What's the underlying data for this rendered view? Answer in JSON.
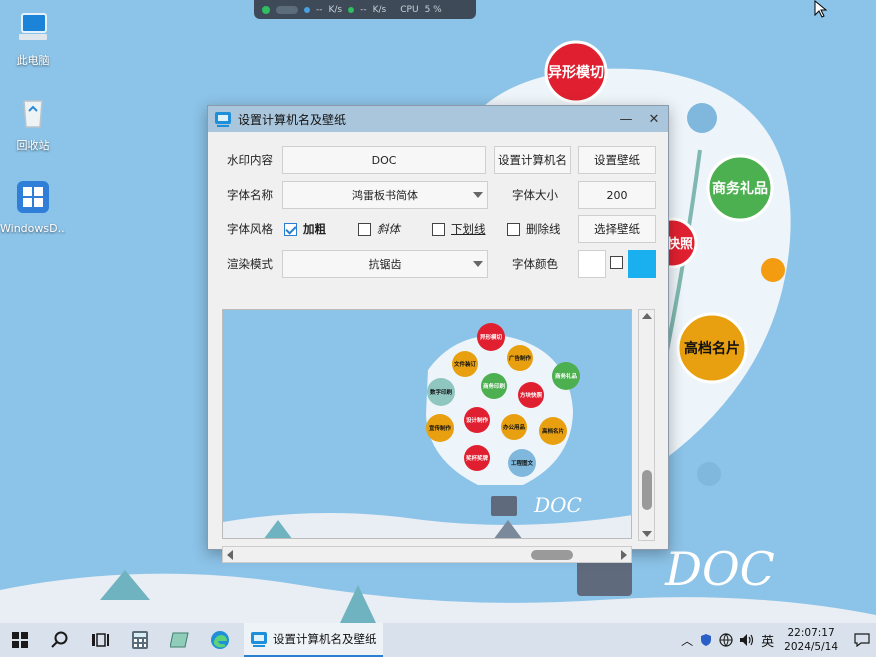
{
  "desktop": {
    "icons": [
      {
        "label": "此电脑"
      },
      {
        "label": "回收站"
      },
      {
        "label": "WindowsD..."
      }
    ]
  },
  "netmonitor": {
    "up": "--",
    "up_unit": "K/s",
    "down": "--",
    "down_unit": "K/s",
    "cpu_label": "CPU",
    "cpu_value": "5 %"
  },
  "wallpaper": {
    "bubbles": [
      "异形模切",
      "商务礼品",
      "快照",
      "高档名片"
    ],
    "watermark": "DOC"
  },
  "dialog": {
    "title": "设置计算机名及壁纸",
    "labels": {
      "watermark": "水印内容",
      "font_name": "字体名称",
      "font_style": "字体风格",
      "render_mode": "渲染模式",
      "font_size": "字体大小",
      "font_color": "字体颜色"
    },
    "watermark_value": "DOC",
    "font_name_value": "鸿雷板书简体",
    "font_size_value": "200",
    "render_mode_value": "抗锯齿",
    "buttons": {
      "set_computer_name": "设置计算机名",
      "set_wallpaper": "设置壁纸",
      "choose_wallpaper": "选择壁纸"
    },
    "styles": [
      {
        "label": "加粗",
        "checked": true
      },
      {
        "label": "斜体",
        "checked": false
      },
      {
        "label": "下划线",
        "checked": false
      },
      {
        "label": "删除线",
        "checked": false
      }
    ],
    "colors": {
      "font_color": "#ffffff",
      "accent": "#1ab0f0"
    },
    "preview": {
      "bubbles": [
        "异形模切",
        "文件装订",
        "广告制作",
        "商务礼品",
        "数字印刷",
        "商务印刷",
        "方块快照",
        "宣传制作",
        "设计制作",
        "办公用品",
        "高档名片",
        "奖杯奖牌",
        "工程图文"
      ],
      "watermark": "DOC"
    }
  },
  "taskbar": {
    "active_app": "设置计算机名及壁纸",
    "ime": "英",
    "time": "22:07:17",
    "date": "2024/5/14"
  }
}
